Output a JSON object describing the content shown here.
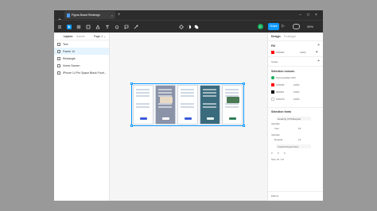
{
  "titlebar": {
    "tab_label": "Figma Board Redesign",
    "tab_close": "×",
    "tab_add": "+",
    "controls": [
      "–",
      "□",
      "×"
    ]
  },
  "toolbar": {
    "avatar_initial": "E",
    "share_label": "Share",
    "play_glyph": "▷",
    "zoom": "39%"
  },
  "left_panel": {
    "tabs": [
      "Layers",
      "Assets"
    ],
    "page": "Page 1 ⌄",
    "layers": [
      {
        "label": "Text",
        "selected": false
      },
      {
        "label": "Frame 14",
        "selected": true
      },
      {
        "label": "Rectangle",
        "selected": false
      },
      {
        "label": "Home Screen",
        "selected": false
      },
      {
        "label": "iPhone 14 Pro Space Black Front...",
        "selected": false
      }
    ]
  },
  "right_panel": {
    "tabs": [
      "Design",
      "Prototype"
    ],
    "fill": {
      "title": "Fill",
      "hex": "FF0000",
      "opacity": "100%"
    },
    "stroke": {
      "title": "Stroke"
    },
    "selection_colors": {
      "title": "Selection colours",
      "items": [
        {
          "hex": "Success/Main 500",
          "opacity": "",
          "color": "#14ae5c"
        },
        {
          "hex": "FF0000",
          "opacity": "100%",
          "color": "#ff0000"
        },
        {
          "hex": "000000",
          "opacity": "100%",
          "color": "#000000"
        },
        {
          "hex": "FFFFFF",
          "opacity": "100%",
          "color": "#ffffff"
        }
      ]
    },
    "selection_fonts": {
      "title": "Selection fonts",
      "font_1": "Heading XXS/Regular",
      "label_1": "Variable",
      "value_1a": "Inter",
      "value_1b": "18",
      "label_2": "Variable",
      "value_2a": "Regular",
      "value_2b": "14",
      "font_2": "Caption/UpperCase",
      "size_2": "Size 10 / 14"
    },
    "effects_label": "Effects",
    "help_glyph": "?"
  },
  "canvas": {
    "screens": [
      {
        "bg": "#ffffff",
        "accent": "#3b5bdb"
      },
      {
        "bg": "#8a93a8",
        "accent": "#ffffff"
      },
      {
        "bg": "#ffffff",
        "accent": "#3b5bdb"
      },
      {
        "bg": "#3a6b7d",
        "accent": "#e8f3f0"
      },
      {
        "bg": "#ffffff",
        "accent": "#2f7d5a"
      }
    ]
  },
  "colors": {
    "accent": "#0d99ff",
    "dark_chrome": "#2c2c2c"
  }
}
